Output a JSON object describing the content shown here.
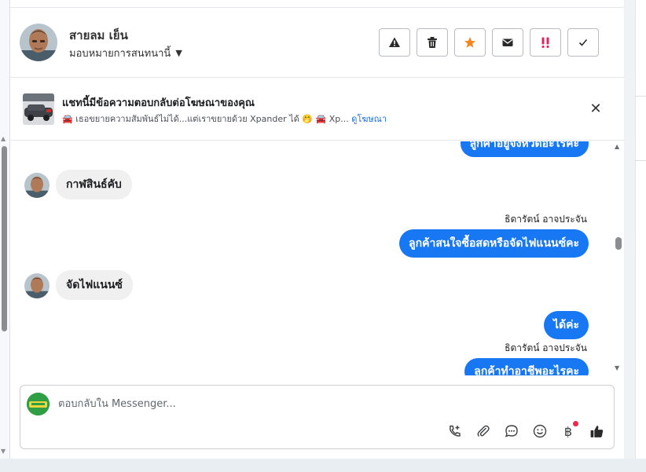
{
  "header": {
    "contact_name": "สายลม เย็น",
    "assign_label": "มอบหมายการสนทนานี้",
    "action_icons": [
      "warning-icon",
      "trash-icon",
      "star-icon",
      "envelope-icon",
      "priority-icon",
      "check-icon"
    ]
  },
  "ad_banner": {
    "title": "แชทนี้มีข้อความตอบกลับต่อโฆษณาของคุณ",
    "snippet": "🚘 เธอขยายความสัมพันธ์ไม่ได้...แต่เราขยายด้วย Xpander ได้ 🤭 🚘 Xp...",
    "link_label": "ดูโฆษณา"
  },
  "messages": [
    {
      "direction": "out",
      "text": "ลูกค้าอยู่จังหวัดอะไรคะ"
    },
    {
      "direction": "in",
      "text": "กาฬสินธ์คับ"
    },
    {
      "direction": "out",
      "sender": "ธิดารัตน์ อาจประจัน",
      "text": "ลูกค้าสนใจซื้อสดหรือจัดไฟแนนซ์คะ"
    },
    {
      "direction": "in",
      "text": "จัดไฟแนนซ์"
    },
    {
      "direction": "out",
      "text": "ได้ค่ะ"
    },
    {
      "direction": "out",
      "sender": "ธิดารัตน์ อาจประจัน",
      "text": "ลูกค้าทำอาชีพอะไรคะ"
    }
  ],
  "composer": {
    "placeholder": "ตอบกลับใน Messenger...",
    "tool_icons": [
      "call-icon",
      "paperclip-icon",
      "chat-icon",
      "emoji-icon",
      "baht-icon",
      "thumbs-up-icon"
    ]
  },
  "colors": {
    "outgoing_bubble": "#1877f2",
    "incoming_bubble": "#f0f0f0",
    "priority_red": "#e0245e",
    "star_orange": "#f5861f",
    "notification_dot": "#f02849"
  }
}
